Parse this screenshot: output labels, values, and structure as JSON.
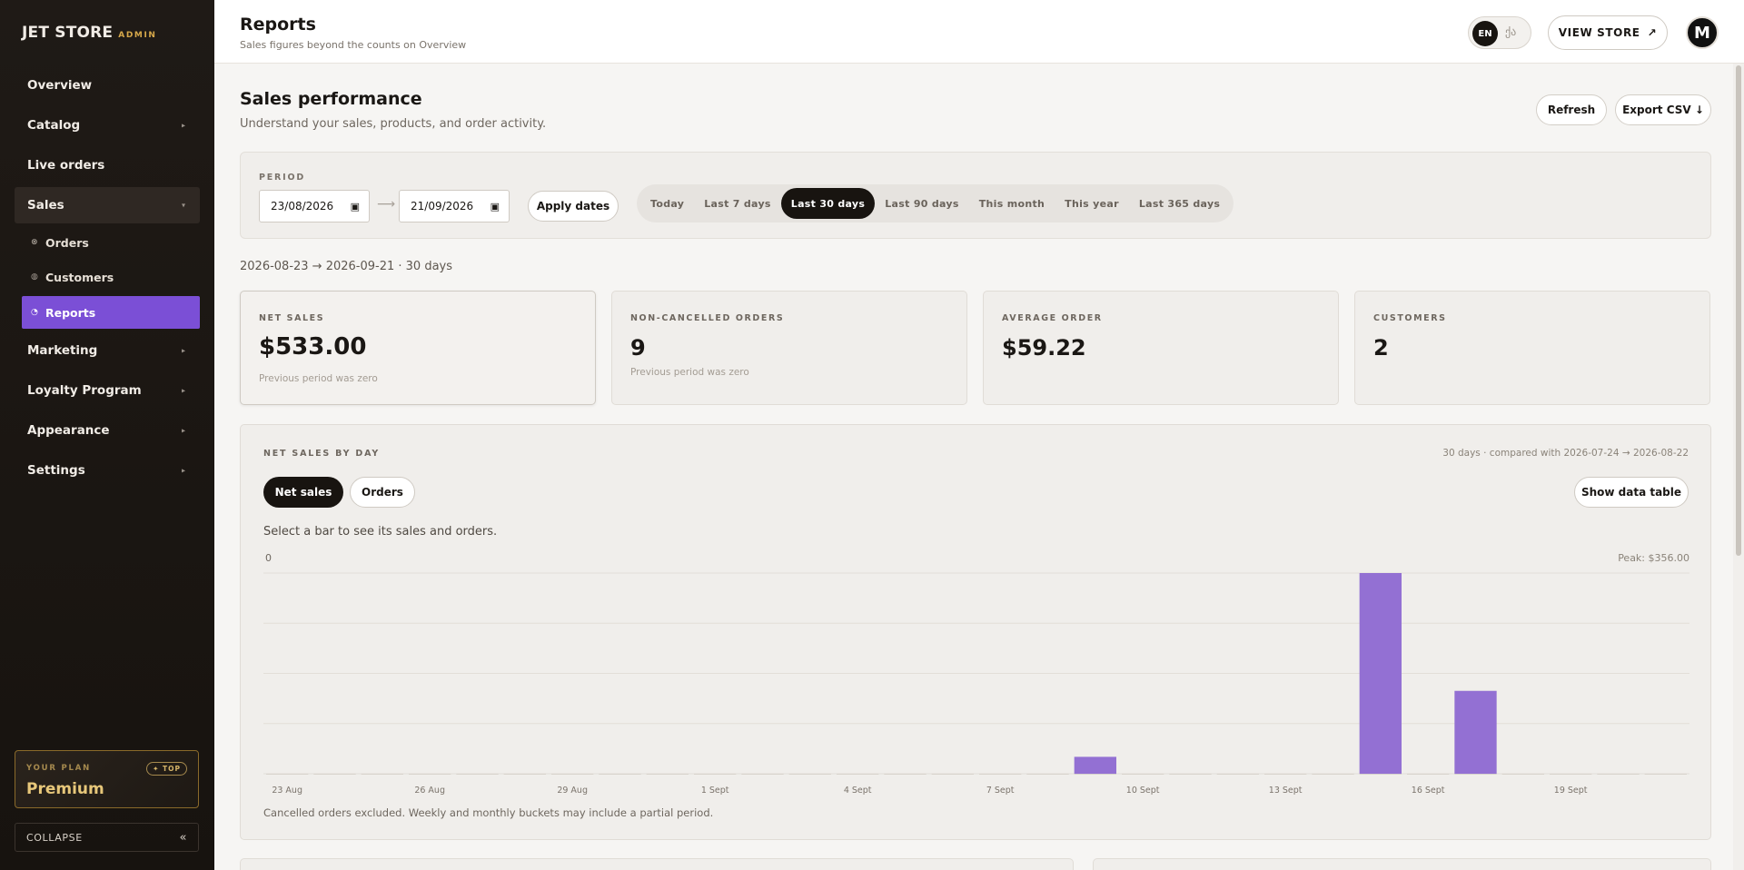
{
  "brand": {
    "name": "JET STORE",
    "sub": "ADMIN"
  },
  "sidebar": {
    "items": [
      {
        "label": "Overview",
        "chevron": false
      },
      {
        "label": "Catalog",
        "chevron": true
      },
      {
        "label": "Live orders",
        "chevron": false
      }
    ],
    "sales": {
      "label": "Sales",
      "children": [
        {
          "label": "Orders",
          "active": false
        },
        {
          "label": "Customers",
          "active": false
        },
        {
          "label": "Reports",
          "active": true
        }
      ]
    },
    "items_after": [
      {
        "label": "Marketing"
      },
      {
        "label": "Loyalty Program"
      },
      {
        "label": "Appearance"
      },
      {
        "label": "Settings"
      }
    ],
    "plan": {
      "label": "YOUR PLAN",
      "name": "Premium",
      "tag": "✦ TOP"
    },
    "collapse": {
      "label": "COLLAPSE",
      "icon": "«"
    }
  },
  "topbar": {
    "title": "Reports",
    "subtitle": "Sales figures beyond the counts on Overview",
    "lang_active": "EN",
    "lang_other": "ქა",
    "view_store": "VIEW STORE",
    "view_store_icon": "↗",
    "avatar": "M"
  },
  "page": {
    "title": "Sales performance",
    "subtitle": "Understand your sales, products, and order activity.",
    "refresh": "Refresh",
    "export": "Export CSV ↓"
  },
  "period": {
    "label": "PERIOD",
    "from": "23/08/2026",
    "to": "21/09/2026",
    "apply": "Apply dates",
    "ranges": [
      "Today",
      "Last 7 days",
      "Last 30 days",
      "Last 90 days",
      "This month",
      "This year",
      "Last 365 days"
    ],
    "active_range": "Last 30 days"
  },
  "range_info": "2026-08-23 → 2026-09-21 · 30 days",
  "stats": [
    {
      "label": "NET SALES",
      "value": "$533.00",
      "note": "Previous period was zero"
    },
    {
      "label": "NON-CANCELLED ORDERS",
      "value": "9",
      "note": "Previous period was zero"
    },
    {
      "label": "AVERAGE ORDER",
      "value": "$59.22",
      "note": ""
    },
    {
      "label": "CUSTOMERS",
      "value": "2",
      "note": ""
    }
  ],
  "chart_card": {
    "label": "NET SALES BY DAY",
    "meta": "30 days · compared with 2026-07-24 → 2026-08-22",
    "toggle_net": "Net sales",
    "toggle_orders": "Orders",
    "show_table": "Show data table",
    "hint": "Select a bar to see its sales and orders.",
    "footnote": "Cancelled orders excluded. Weekly and monthly buckets may include a partial period."
  },
  "chart_data": {
    "type": "bar",
    "categories": [
      "23 Aug",
      "24 Aug",
      "25 Aug",
      "26 Aug",
      "27 Aug",
      "28 Aug",
      "29 Aug",
      "30 Aug",
      "31 Aug",
      "1 Sept",
      "2 Sept",
      "3 Sept",
      "4 Sept",
      "5 Sept",
      "6 Sept",
      "7 Sept",
      "8 Sept",
      "9 Sept",
      "10 Sept",
      "11 Sept",
      "12 Sept",
      "13 Sept",
      "14 Sept",
      "15 Sept",
      "16 Sept",
      "17 Sept",
      "18 Sept",
      "19 Sept",
      "20 Sept",
      "21 Sept"
    ],
    "tick_labels": [
      "23 Aug",
      "26 Aug",
      "29 Aug",
      "1 Sept",
      "4 Sept",
      "7 Sept",
      "10 Sept",
      "13 Sept",
      "16 Sept",
      "19 Sept"
    ],
    "values": [
      0,
      0,
      0,
      0,
      0,
      0,
      0,
      0,
      0,
      0,
      0,
      0,
      0,
      0,
      0,
      0,
      0,
      30,
      0,
      0,
      0,
      0,
      0,
      356,
      0,
      147,
      0,
      0,
      0,
      0
    ],
    "ylim": [
      0,
      356
    ],
    "y_top_label": "0",
    "peak_label": "Peak: $356.00",
    "bar_color": "#9370d3",
    "grid": true
  }
}
